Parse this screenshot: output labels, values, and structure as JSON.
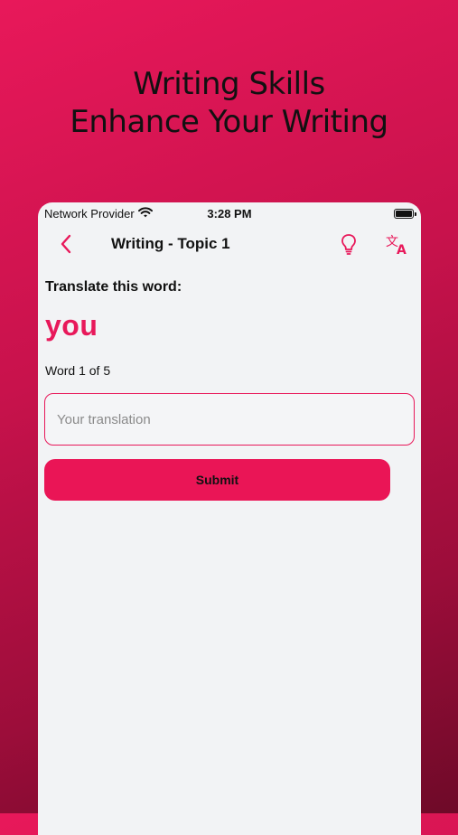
{
  "headline": {
    "line1": "Writing Skills",
    "line2": "Enhance Your Writing"
  },
  "status_bar": {
    "carrier": "Network Provider",
    "time": "3:28 PM",
    "wifi_icon": "wifi-icon",
    "battery_icon": "battery-icon"
  },
  "nav": {
    "title": "Writing - Topic 1",
    "back_icon": "chevron-left-icon",
    "hint_icon": "lightbulb-icon",
    "translate_icon": "translate-icon"
  },
  "exercise": {
    "prompt": "Translate this word:",
    "word": "you",
    "counter": "Word 1 of 5",
    "input_value": "",
    "input_placeholder": "Your translation",
    "submit_label": "Submit"
  },
  "colors": {
    "accent": "#e8185a",
    "background_gradient_start": "#e8185a",
    "background_gradient_end": "#6e0a28",
    "screen_bg": "#f2f3f5"
  }
}
